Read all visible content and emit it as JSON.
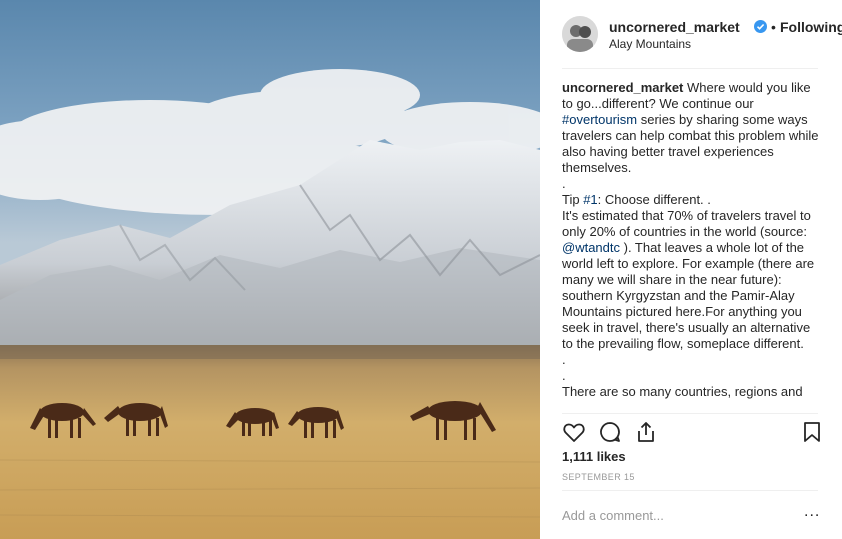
{
  "post": {
    "username": "uncornered_market",
    "follow_state": "Following",
    "dot": "•",
    "location": "Alay Mountains",
    "likes": "1,111 likes",
    "date": "SEPTEMBER 15"
  },
  "caption": {
    "author": "uncornered_market",
    "line1_text": "Where would you like to go...different? We continue our ",
    "hashtag": "#overtourism",
    "line1_rest": " series by sharing some ways travelers can help combat this problem while also having better travel experiences themselves.",
    "sep1": ".",
    "tip_prefix": "Tip ",
    "tip_tag": "#1",
    "tip_text": ": Choose different. .",
    "body1": "It's estimated that 70% of travelers travel to only 20% of countries in the world (source: ",
    "mention": "@wtandtc",
    "body2": " ). That leaves a whole lot of the world left to explore. For example (there are many we will share in the near future): southern Kyrgyzstan and the Pamir-Alay Mountains pictured here.For anything you seek in travel, there's usually an alternative to the prevailing flow, someplace different.",
    "sep2": ".",
    "sep3": ".",
    "body3": "There are so many countries, regions and"
  },
  "comment": {
    "placeholder": "Add a comment...",
    "more_label": "..."
  },
  "icons": [
    "verified-icon",
    "heart-icon",
    "comment-icon",
    "share-icon",
    "bookmark-icon",
    "more-icon"
  ],
  "colors": {
    "link": "#003569",
    "verified": "#3897f0",
    "muted": "#999999",
    "text": "#262626"
  }
}
